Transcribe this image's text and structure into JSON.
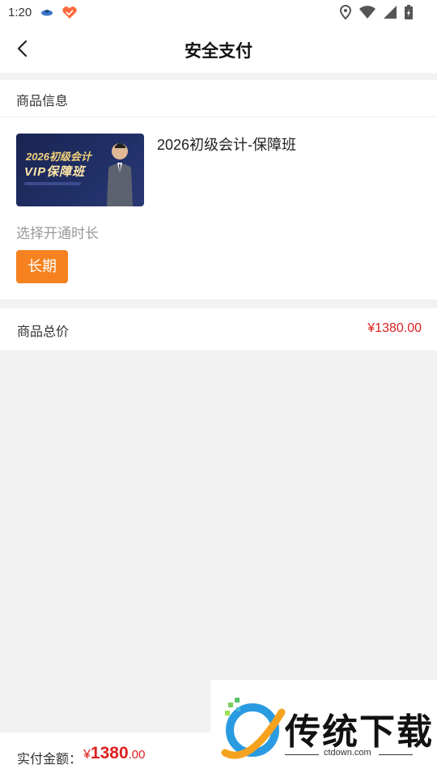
{
  "status_bar": {
    "time": "1:20",
    "icons": [
      "app-icon",
      "heart-app-icon",
      "location-icon",
      "wifi-icon",
      "signal-icon",
      "battery-icon"
    ]
  },
  "nav": {
    "title": "安全支付",
    "back_icon": "chevron-left-icon"
  },
  "goods": {
    "header": "商品信息",
    "title": "2026初级会计-保障班",
    "thumbnail": {
      "year_text": "2026初级会计",
      "class_text": "VIP保障班"
    },
    "duration_label": "选择开通时长",
    "duration_option": "长期"
  },
  "total": {
    "label": "商品总价",
    "value": "¥1380.00"
  },
  "bottom_bar": {
    "label": "实付金额：",
    "yen": "¥",
    "amount_int": "1380",
    "amount_dec": ".00"
  },
  "watermark": {
    "brand": "传统下载",
    "url": "ctdown.com"
  },
  "colors": {
    "accent_orange": "#f5821f",
    "price_red": "#e02020",
    "page_bg": "#f2f2f2"
  }
}
